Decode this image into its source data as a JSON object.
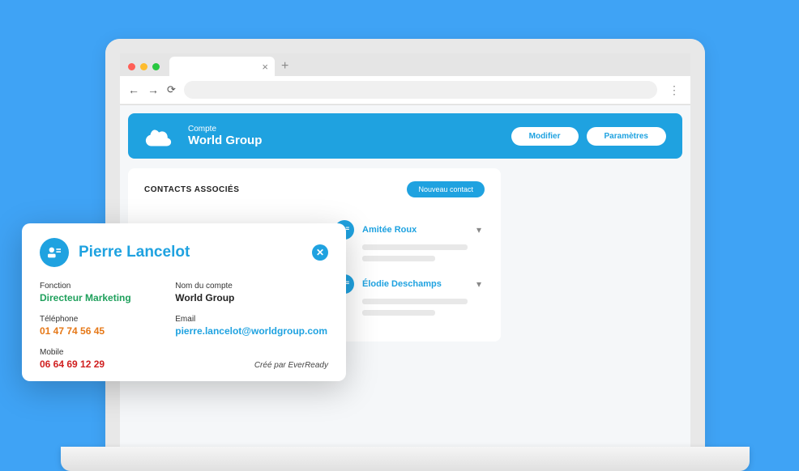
{
  "browser": {
    "plus_label": "+",
    "close_tab": "×",
    "more": "⋮"
  },
  "header": {
    "subtitle": "Compte",
    "title": "World Group",
    "buttons": {
      "modify": "Modifier",
      "settings": "Paramètres"
    }
  },
  "contacts_panel": {
    "title": "CONTACTS ASSOCIÉS",
    "new_button": "Nouveau contact",
    "items": [
      {
        "name": "Amitée Roux"
      },
      {
        "name": "Élodie Deschamps"
      }
    ]
  },
  "contact_card": {
    "name": "Pierre Lancelot",
    "fields": {
      "fonction_label": "Fonction",
      "fonction_value": "Directeur Marketing",
      "account_label": "Nom du compte",
      "account_value": "World Group",
      "phone_label": "Téléphone",
      "phone_value": "01 47 74 56 45",
      "email_label": "Email",
      "email_value": "pierre.lancelot@worldgroup.com",
      "mobile_label": "Mobile",
      "mobile_value": "06 64 69 12 29"
    },
    "footer": "Créé par EverReady"
  }
}
